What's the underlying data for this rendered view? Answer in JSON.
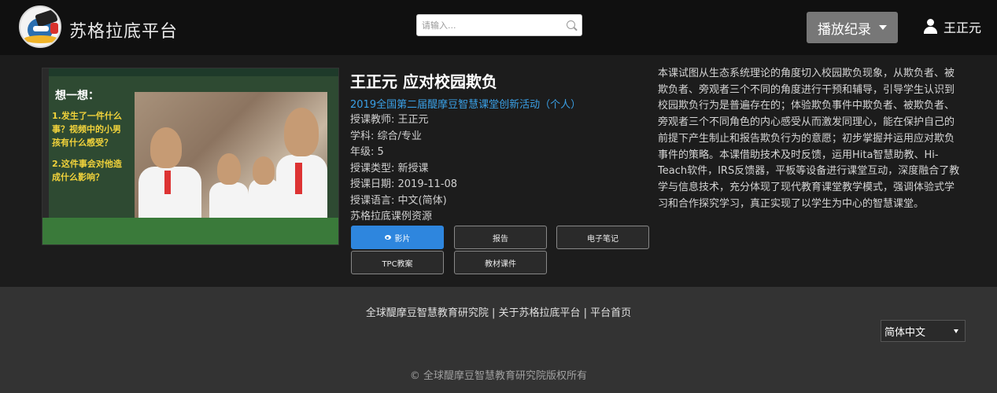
{
  "header": {
    "brand": "苏格拉底平台",
    "search_placeholder": "请输入...",
    "history_label": "播放纪录",
    "user_name": "王正元"
  },
  "lesson": {
    "title": "王正元 应对校园欺负",
    "event": "2019全国第二届醍摩豆智慧课堂创新活动（个人）",
    "teacher": "授课教师: 王正元",
    "subject": "学科: 综合/专业",
    "grade": "年级: 5",
    "type": "授课类型: 新授课",
    "date": "授课日期: 2019-11-08",
    "language": "授课语言: 中文(简体)",
    "source": "苏格拉底课例资源",
    "thumbnail": {
      "board_title": "想一想：",
      "board_lines": [
        "1.发生了一件什么",
        "事？视频中的小男",
        "孩有什么感受？",
        "",
        "2.这件事会对他造",
        "成什么影响？"
      ]
    },
    "buttons": {
      "video": "影片",
      "report": "报告",
      "notes": "电子笔记",
      "tpc": "TPC教案",
      "materials": "教材课件"
    },
    "description": "本课试图从生态系统理论的角度切入校园欺负现象，从欺负者、被欺负者、旁观者三个不同的角度进行干预和辅导，引导学生认识到校园欺负行为是普遍存在的；体验欺负事件中欺负者、被欺负者、旁观者三个不同角色的内心感受从而激发同理心，能在保护自己的前提下产生制止和报告欺负行为的意愿；初步掌握并运用应对欺负事件的策略。本课借助技术及时反馈，运用Hita智慧助教、Hi-Teach软件，IRS反馈器，平板等设备进行课堂互动，深度融合了教学与信息技术，充分体现了现代教育课堂教学模式，强调体验式学习和合作探究学习，真正实现了以学生为中心的智慧课堂。"
  },
  "footer": {
    "link_institute": "全球醍摩豆智慧教育研究院",
    "sep1": " | ",
    "link_about": "关于苏格拉底平台",
    "sep2": " | ",
    "link_home": "平台首页",
    "language_selected": "简体中文",
    "copyright": "© 全球醍摩豆智慧教育研究院版权所有"
  }
}
